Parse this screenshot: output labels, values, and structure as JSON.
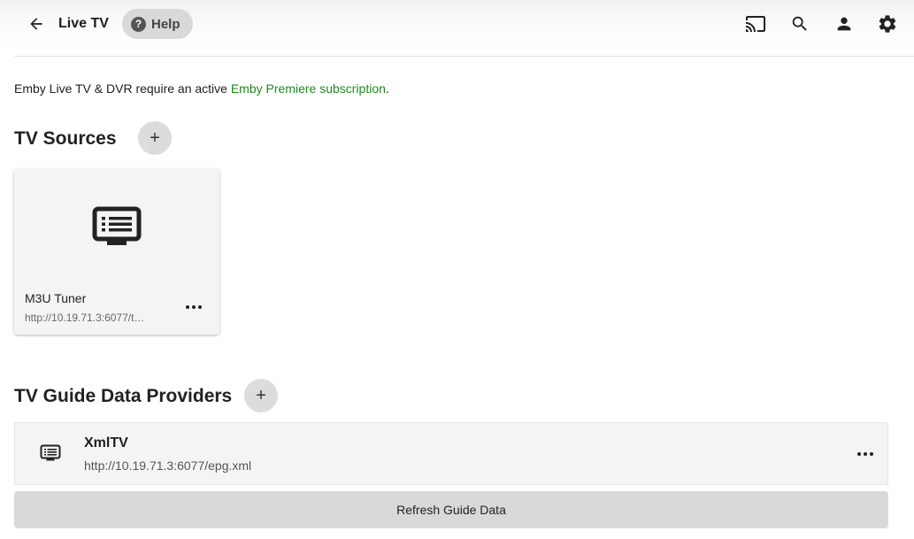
{
  "header": {
    "title": "Live TV",
    "help_label": "Help",
    "icons": [
      "back-arrow-icon",
      "cast-icon",
      "search-icon",
      "user-icon",
      "settings-gear-icon"
    ]
  },
  "notice": {
    "prefix": "Emby Live TV & DVR require an active ",
    "link": "Emby Premiere subscription",
    "suffix": "."
  },
  "tv_sources": {
    "title": "TV Sources",
    "add_label": "+",
    "items": [
      {
        "name": "M3U Tuner",
        "url": "http://10.19.71.3:6077/t…",
        "icon": "tv-guide-icon"
      }
    ]
  },
  "guide_providers": {
    "title": "TV Guide Data Providers",
    "add_label": "+",
    "items": [
      {
        "name": "XmlTV",
        "url": "http://10.19.71.3:6077/epg.xml",
        "icon": "tv-guide-icon"
      }
    ]
  },
  "refresh_label": "Refresh Guide Data"
}
